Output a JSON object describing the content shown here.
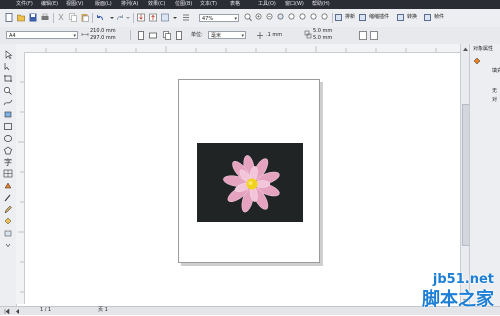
{
  "menu": [
    "文件(F)",
    "编辑(E)",
    "视图(V)",
    "版面(L)",
    "排列(A)",
    "效果(C)",
    "位图(B)",
    "文本(T)",
    "表格",
    "工具(O)",
    "窗口(W)",
    "帮助(H)"
  ],
  "toolbar": {
    "zoom_value": "47%",
    "paste_label": "排新",
    "plugin_label": "缩缩插件",
    "convert_label": "转换",
    "frame_label": "帧件"
  },
  "propbar": {
    "paper_size": "A4",
    "width": "210.0 mm",
    "height": "297.0 mm",
    "unit_label": "单位:",
    "unit_value": "毫米",
    "nudge": ".1 mm",
    "dup_x": "5.0 mm",
    "dup_y": "5.0 mm"
  },
  "docker": {
    "title": "对象属性",
    "line1": "填充",
    "line2": "无",
    "line3": "对"
  },
  "status": {
    "page_label": "页 1",
    "page_count": "1 / 1"
  },
  "watermark": {
    "domain": "jb51.net",
    "name": "脚本之家"
  },
  "colors": {
    "menubar": "#2b2d35",
    "photo_bg": "#202425",
    "petal": "#e7a9c3",
    "center": "#f1d21e",
    "watermark_blue": "#1e7fd4"
  }
}
